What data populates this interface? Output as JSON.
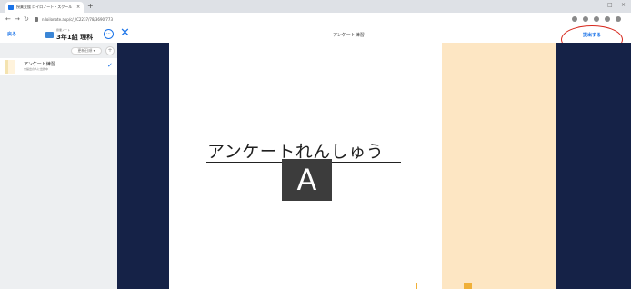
{
  "browser": {
    "tab_title": "授業支援 ロイロノート・スクール",
    "tab_close": "×",
    "new_tab": "+",
    "url": "n.loilonote.app/c/_/C2237/78/3690/773",
    "window_controls": [
      "–",
      "□",
      "×"
    ]
  },
  "header": {
    "back_label": "戻る",
    "breadcrumb_small": "授業ノート",
    "breadcrumb_title": "3年1組 理科",
    "share_icon": "share-icon",
    "close_symbol": "✕",
    "center_title": "アンケート練習",
    "submit_label": "提出する"
  },
  "sidebar": {
    "sort_label": "更新日順 ▾",
    "add_symbol": "+",
    "items": [
      {
        "title": "アンケート練習",
        "subtitle": "未提出の人に出題中",
        "check": "✓"
      }
    ]
  },
  "canvas": {
    "title_text": "アンケートれんしゅう",
    "tile_letter": "A"
  },
  "colors": {
    "accent": "#1a73e8",
    "navy": "#152247",
    "peach": "#fde6c3",
    "annotation_red": "#d7281d"
  }
}
